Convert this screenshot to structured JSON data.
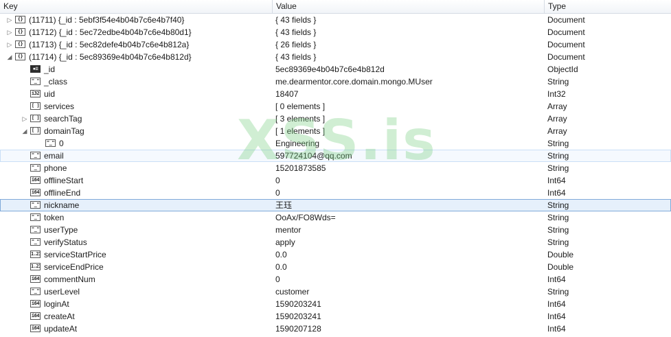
{
  "columns": {
    "key": "Key",
    "value": "Value",
    "type": "Type"
  },
  "icons": {
    "doc": "{}",
    "str": "\"_\"",
    "i32": "i32",
    "i64": "i64",
    "dbl": "1.23",
    "arr": "[ ]",
    "oid": "id-card"
  },
  "rows": [
    {
      "indent": 0,
      "twisty": "▷",
      "icon": "{}",
      "iconName": "document-icon",
      "key": "(11711) {_id : 5ebf3f54e4b04b7c6e4b7f40}",
      "value": "{ 43 fields }",
      "type": "Document"
    },
    {
      "indent": 0,
      "twisty": "▷",
      "icon": "{}",
      "iconName": "document-icon",
      "key": "(11712) {_id : 5ec72edbe4b04b7c6e4b80d1}",
      "value": "{ 43 fields }",
      "type": "Document"
    },
    {
      "indent": 0,
      "twisty": "▷",
      "icon": "{}",
      "iconName": "document-icon",
      "key": "(11713) {_id : 5ec82defe4b04b7c6e4b812a}",
      "value": "{ 26 fields }",
      "type": "Document"
    },
    {
      "indent": 0,
      "twisty": "◢",
      "icon": "{}",
      "iconName": "document-icon",
      "key": "(11714) {_id : 5ec89369e4b04b7c6e4b812d}",
      "value": "{ 43 fields }",
      "type": "Document"
    },
    {
      "indent": 1,
      "twisty": "",
      "icon": "▪≡",
      "iconName": "objectid-icon",
      "dark": true,
      "key": "_id",
      "value": "5ec89369e4b04b7c6e4b812d",
      "type": "ObjectId"
    },
    {
      "indent": 1,
      "twisty": "",
      "icon": "\"_\"",
      "iconName": "string-icon",
      "key": "_class",
      "value": "me.dearmentor.core.domain.mongo.MUser",
      "type": "String"
    },
    {
      "indent": 1,
      "twisty": "",
      "icon": "i32",
      "iconName": "int32-icon",
      "key": "uid",
      "value": "18407",
      "type": "Int32"
    },
    {
      "indent": 1,
      "twisty": "",
      "icon": "[ ]",
      "iconName": "array-icon",
      "key": "services",
      "value": "[ 0 elements ]",
      "type": "Array"
    },
    {
      "indent": 1,
      "twisty": "▷",
      "icon": "[ ]",
      "iconName": "array-icon",
      "key": "searchTag",
      "value": "[ 3 elements ]",
      "type": "Array"
    },
    {
      "indent": 1,
      "twisty": "◢",
      "icon": "[ ]",
      "iconName": "array-icon",
      "key": "domainTag",
      "value": "[ 1 elements ]",
      "type": "Array"
    },
    {
      "indent": 2,
      "twisty": "",
      "icon": "\"_\"",
      "iconName": "string-icon",
      "key": "0",
      "value": "Engineering",
      "type": "String"
    },
    {
      "indent": 1,
      "twisty": "",
      "icon": "\"_\"",
      "iconName": "string-icon",
      "key": "email",
      "value": "597724104@qq.com",
      "type": "String",
      "hl": "soft"
    },
    {
      "indent": 1,
      "twisty": "",
      "icon": "\"_\"",
      "iconName": "string-icon",
      "key": "phone",
      "value": "15201873585",
      "type": "String"
    },
    {
      "indent": 1,
      "twisty": "",
      "icon": "i64",
      "iconName": "int64-icon",
      "key": "offlineStart",
      "value": "0",
      "type": "Int64"
    },
    {
      "indent": 1,
      "twisty": "",
      "icon": "i64",
      "iconName": "int64-icon",
      "key": "offlineEnd",
      "value": "0",
      "type": "Int64"
    },
    {
      "indent": 1,
      "twisty": "",
      "icon": "\"_\"",
      "iconName": "string-icon",
      "key": "nickname",
      "value": "王珏",
      "type": "String",
      "hl": "sel"
    },
    {
      "indent": 1,
      "twisty": "",
      "icon": "\"_\"",
      "iconName": "string-icon",
      "key": "token",
      "value": "OoAx/FO8Wds=",
      "type": "String"
    },
    {
      "indent": 1,
      "twisty": "",
      "icon": "\"_\"",
      "iconName": "string-icon",
      "key": "userType",
      "value": "mentor",
      "type": "String"
    },
    {
      "indent": 1,
      "twisty": "",
      "icon": "\"_\"",
      "iconName": "string-icon",
      "key": "verifyStatus",
      "value": "apply",
      "type": "String"
    },
    {
      "indent": 1,
      "twisty": "",
      "icon": "1.23",
      "iconName": "double-icon",
      "key": "serviceStartPrice",
      "value": "0.0",
      "type": "Double"
    },
    {
      "indent": 1,
      "twisty": "",
      "icon": "1.23",
      "iconName": "double-icon",
      "key": "serviceEndPrice",
      "value": "0.0",
      "type": "Double"
    },
    {
      "indent": 1,
      "twisty": "",
      "icon": "i64",
      "iconName": "int64-icon",
      "key": "commentNum",
      "value": "0",
      "type": "Int64"
    },
    {
      "indent": 1,
      "twisty": "",
      "icon": "\"_\"",
      "iconName": "string-icon",
      "key": "userLevel",
      "value": "customer",
      "type": "String"
    },
    {
      "indent": 1,
      "twisty": "",
      "icon": "i64",
      "iconName": "int64-icon",
      "key": "loginAt",
      "value": "1590203241",
      "type": "Int64"
    },
    {
      "indent": 1,
      "twisty": "",
      "icon": "i64",
      "iconName": "int64-icon",
      "key": "createAt",
      "value": "1590203241",
      "type": "Int64"
    },
    {
      "indent": 1,
      "twisty": "",
      "icon": "i64",
      "iconName": "int64-icon",
      "key": "updateAt",
      "value": "1590207128",
      "type": "Int64"
    }
  ],
  "watermark": "XSS.is"
}
